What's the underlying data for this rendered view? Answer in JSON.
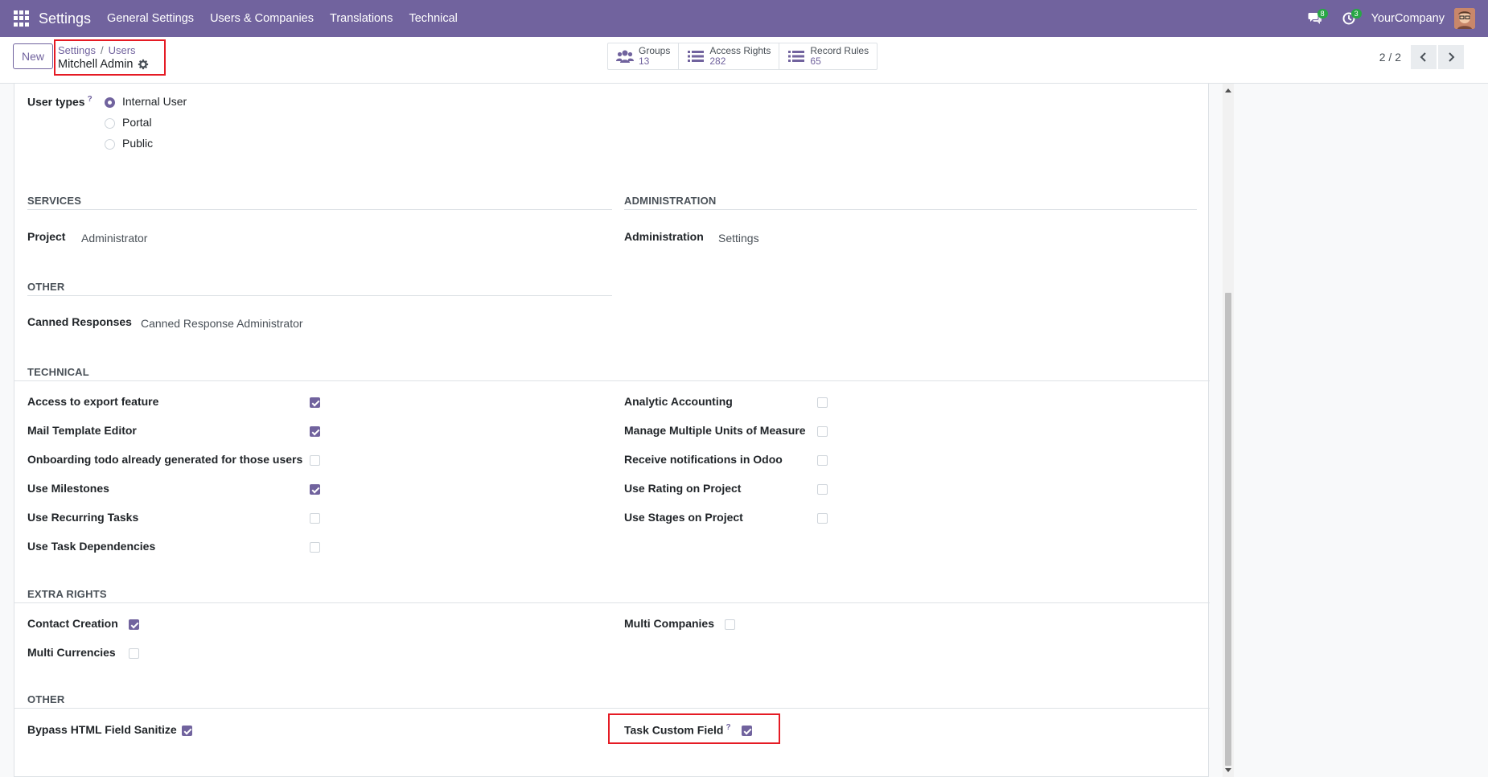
{
  "navbar": {
    "brand": "Settings",
    "menu": [
      "General Settings",
      "Users & Companies",
      "Translations",
      "Technical"
    ],
    "messages_badge": "8",
    "activities_badge": "3",
    "company": "YourCompany"
  },
  "control": {
    "new_label": "New",
    "breadcrumb": [
      "Settings",
      "Users"
    ],
    "record_title": "Mitchell Admin",
    "smart_buttons": [
      {
        "label": "Groups",
        "value": "13",
        "icon": "users-icon"
      },
      {
        "label": "Access Rights",
        "value": "282",
        "icon": "list-icon"
      },
      {
        "label": "Record Rules",
        "value": "65",
        "icon": "list-icon"
      }
    ],
    "pager": "2 / 2"
  },
  "user_types": {
    "label": "User types",
    "help": "?",
    "options": [
      {
        "label": "Internal User",
        "checked": true
      },
      {
        "label": "Portal",
        "checked": false
      },
      {
        "label": "Public",
        "checked": false
      }
    ]
  },
  "services": {
    "title": "SERVICES",
    "field_label": "Project",
    "field_value": "Administrator"
  },
  "administration": {
    "title": "ADMINISTRATION",
    "field_label": "Administration",
    "field_value": "Settings"
  },
  "other1": {
    "title": "OTHER",
    "field_label": "Canned Responses",
    "field_value": "Canned Response Administrator"
  },
  "technical": {
    "title": "TECHNICAL",
    "left": [
      {
        "label": "Access to export feature",
        "checked": true
      },
      {
        "label": "Mail Template Editor",
        "checked": true
      },
      {
        "label": "Onboarding todo already generated for those users",
        "checked": false
      },
      {
        "label": "Use Milestones",
        "checked": true
      },
      {
        "label": "Use Recurring Tasks",
        "checked": false
      },
      {
        "label": "Use Task Dependencies",
        "checked": false
      }
    ],
    "right": [
      {
        "label": "Analytic Accounting",
        "checked": false
      },
      {
        "label": "Manage Multiple Units of Measure",
        "checked": false
      },
      {
        "label": "Receive notifications in Odoo",
        "checked": false
      },
      {
        "label": "Use Rating on Project",
        "checked": false
      },
      {
        "label": "Use Stages on Project",
        "checked": false
      }
    ]
  },
  "extra_rights": {
    "title": "EXTRA RIGHTS",
    "left": [
      {
        "label": "Contact Creation",
        "checked": true
      },
      {
        "label": "Multi Currencies",
        "checked": false
      }
    ],
    "right": [
      {
        "label": "Multi Companies",
        "checked": false
      }
    ]
  },
  "other2": {
    "title": "OTHER",
    "left": [
      {
        "label": "Bypass HTML Field Sanitize",
        "checked": true
      }
    ],
    "right": [
      {
        "label": "Task Custom Field",
        "help": "?",
        "checked": true
      }
    ]
  },
  "colors": {
    "brand": "#71639e",
    "highlight": "#e51b24"
  }
}
